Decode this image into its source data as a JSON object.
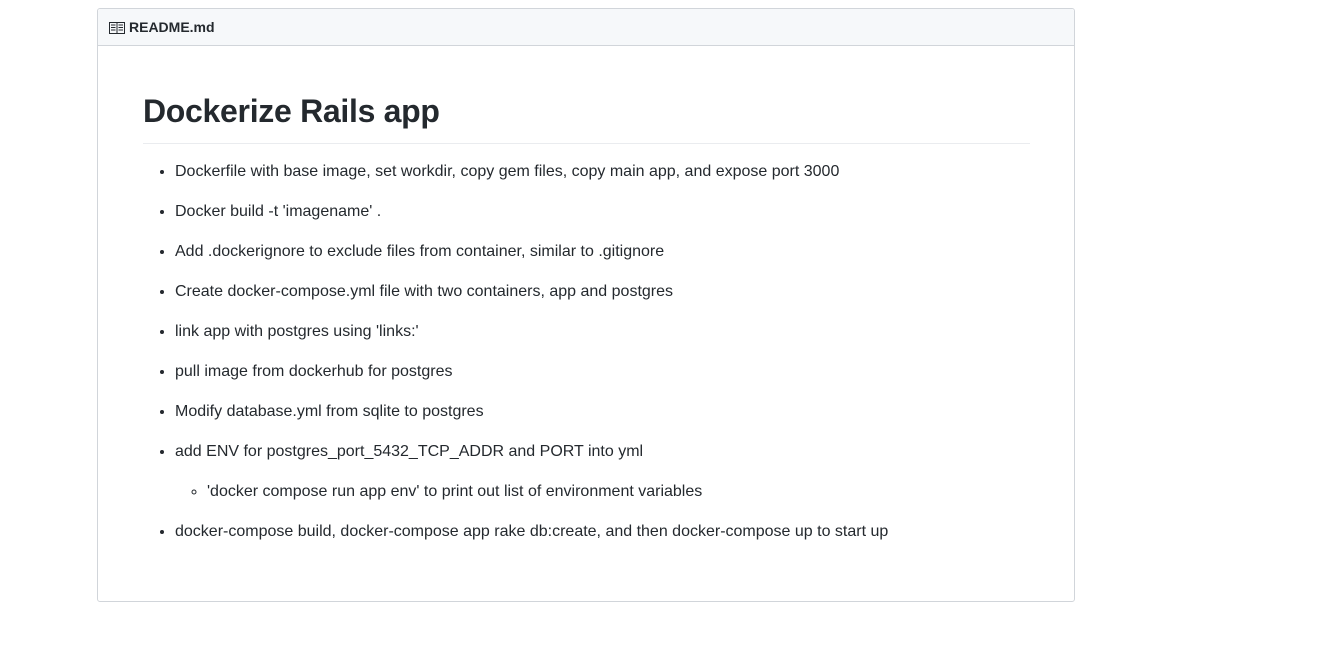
{
  "readme": {
    "icon": "book-icon",
    "filename": "README.md",
    "title": "Dockerize Rails app",
    "items": [
      "Dockerfile with base image, set workdir, copy gem files, copy main app, and expose port 3000",
      "Docker build -t 'imagename' .",
      "Add .dockerignore to exclude files from container, similar to .gitignore",
      "Create docker-compose.yml file with two containers, app and postgres",
      "link app with postgres using 'links:'",
      "pull image from dockerhub for postgres",
      "Modify database.yml from sqlite to postgres",
      "add ENV for postgres_port_5432_TCP_ADDR and PORT into yml",
      "docker-compose build, docker-compose app rake db:create, and then docker-compose up to start up"
    ],
    "subitems": [
      "'docker compose run app env' to print out list of environment variables"
    ]
  },
  "colors": {
    "text": "#24292e",
    "border": "#d1d5da",
    "header_bg": "#f6f8fa",
    "rule": "#eaecef"
  }
}
